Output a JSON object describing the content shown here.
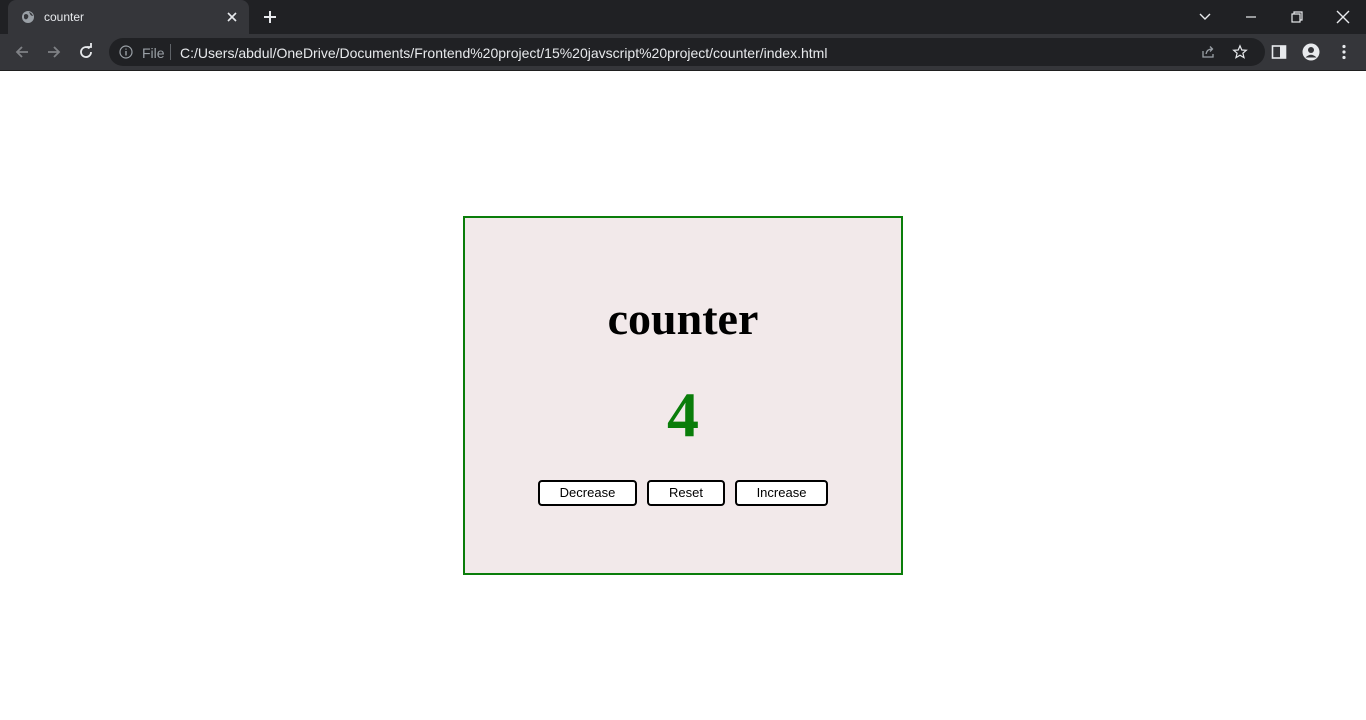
{
  "browser": {
    "tab_title": "counter",
    "address_scheme": "File",
    "url": "C:/Users/abdul/OneDrive/Documents/Frontend%20project/15%20javscript%20project/counter/index.html"
  },
  "page": {
    "title": "counter",
    "count_value": "4",
    "count_color": "#0a7d0a",
    "buttons": {
      "decrease": "Decrease",
      "reset": "Reset",
      "increase": "Increase"
    }
  },
  "colors": {
    "card_background": "#f2e9ea",
    "card_border": "#0a7d0a"
  },
  "icons": [
    "globe-icon",
    "close-icon",
    "plus-icon",
    "chevron-down-icon",
    "minimize-icon",
    "restore-icon",
    "back-icon",
    "forward-icon",
    "reload-icon",
    "info-icon",
    "share-icon",
    "star-icon",
    "side-panel-icon",
    "profile-icon",
    "menu-icon"
  ]
}
